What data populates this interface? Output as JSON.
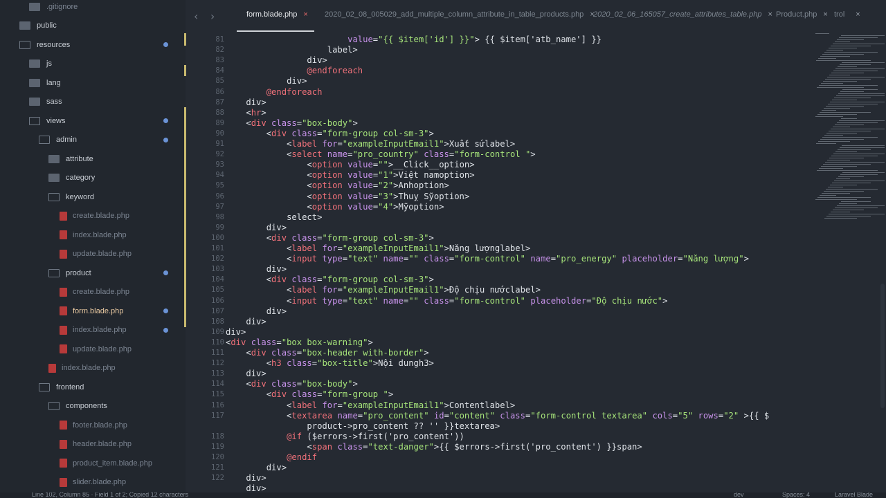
{
  "sidebar": {
    "items": [
      {
        "label": ".gitignore",
        "type": "file-plain",
        "indent": 1,
        "dim": true
      },
      {
        "label": "public",
        "type": "folder",
        "indent": 0
      },
      {
        "label": "resources",
        "type": "folder-open",
        "indent": 0,
        "modified": true
      },
      {
        "label": "js",
        "type": "folder",
        "indent": 1
      },
      {
        "label": "lang",
        "type": "folder",
        "indent": 1
      },
      {
        "label": "sass",
        "type": "folder",
        "indent": 1
      },
      {
        "label": "views",
        "type": "folder-open",
        "indent": 1,
        "modified": true
      },
      {
        "label": "admin",
        "type": "folder-open",
        "indent": 2,
        "modified": true
      },
      {
        "label": "attribute",
        "type": "folder",
        "indent": 3
      },
      {
        "label": "category",
        "type": "folder",
        "indent": 3
      },
      {
        "label": "keyword",
        "type": "folder-open",
        "indent": 3
      },
      {
        "label": "create.blade.php",
        "type": "file",
        "indent": 4,
        "dim": true
      },
      {
        "label": "index.blade.php",
        "type": "file",
        "indent": 4,
        "dim": true
      },
      {
        "label": "update.blade.php",
        "type": "file",
        "indent": 4,
        "dim": true
      },
      {
        "label": "product",
        "type": "folder-open",
        "indent": 3,
        "modified": true
      },
      {
        "label": "create.blade.php",
        "type": "file",
        "indent": 4,
        "dim": true
      },
      {
        "label": "form.blade.php",
        "type": "file",
        "indent": 4,
        "modified": true,
        "active": true
      },
      {
        "label": "index.blade.php",
        "type": "file",
        "indent": 4,
        "modified": true,
        "dim": true
      },
      {
        "label": "update.blade.php",
        "type": "file",
        "indent": 4,
        "dim": true
      },
      {
        "label": "index.blade.php",
        "type": "file",
        "indent": 3,
        "dim": true
      },
      {
        "label": "frontend",
        "type": "folder-open",
        "indent": 2
      },
      {
        "label": "components",
        "type": "folder-open",
        "indent": 3
      },
      {
        "label": "footer.blade.php",
        "type": "file",
        "indent": 4,
        "dim": true
      },
      {
        "label": "header.blade.php",
        "type": "file",
        "indent": 4,
        "dim": true
      },
      {
        "label": "product_item.blade.php",
        "type": "file",
        "indent": 4,
        "dim": true
      },
      {
        "label": "slider.blade.php",
        "type": "file",
        "indent": 4,
        "dim": true
      }
    ]
  },
  "tabs": [
    {
      "label": "form.blade.php",
      "active": true
    },
    {
      "label": "2020_02_08_005029_add_multiple_column_attribute_in_table_products.php",
      "active": false
    },
    {
      "label": "2020_02_06_165057_create_attributes_table.php",
      "active": false
    },
    {
      "label": "Product.php",
      "active": false
    },
    {
      "label": "trol",
      "active": false
    }
  ],
  "nav": {
    "back": "‹",
    "forward": "›"
  },
  "editor": {
    "current_line": 102,
    "lines": [
      {
        "n": "81",
        "html": "                        <span class='a'>value</span>=<span class='s'>\"{{ $item['id'] }}\"</span>> {{ $item['atb_name'] }}"
      },
      {
        "n": "82",
        "html": "                    </<span class='t'>label</span>>"
      },
      {
        "n": "83",
        "html": "                </<span class='t'>div</span>>"
      },
      {
        "n": "84",
        "html": "                <span class='b'>@</span><span class='t'>endforeach</span>"
      },
      {
        "n": "85",
        "html": "            </<span class='t'>div</span>>"
      },
      {
        "n": "86",
        "html": "        <span class='b'>@</span><span class='t'>endforeach</span>"
      },
      {
        "n": "87",
        "html": "    </<span class='t'>div</span>>"
      },
      {
        "n": "88",
        "html": "    <<span class='t'>hr</span>>"
      },
      {
        "n": "89",
        "html": "    <<span class='t'>div</span> <span class='a'>class</span>=<span class='s'>\"box-body\"</span>>"
      },
      {
        "n": "90",
        "html": "        <<span class='t'>div</span> <span class='a'>class</span>=<span class='s'>\"form-group col-sm-3\"</span>>"
      },
      {
        "n": "91",
        "html": "            <<span class='t'>label</span> <span class='a'>for</span>=<span class='s'>\"exampleInputEmail1\"</span>>Xuất sứ</<span class='t'>label</span>>"
      },
      {
        "n": "92",
        "html": "            <<span class='t'>select</span> <span class='a'>name</span>=<span class='s'>\"pro_country\"</span> <span class='a'>class</span>=<span class='s'>\"form-control \"</span>>"
      },
      {
        "n": "93",
        "html": "                <<span class='t'>option</span> <span class='a'>value</span>=<span class='s'>\"\"</span>>__Click__</<span class='t'>option</span>>"
      },
      {
        "n": "94",
        "html": "                <<span class='t'>option</span> <span class='a'>value</span>=<span class='s'>\"1\"</span>>Việt nam</<span class='t'>option</span>>"
      },
      {
        "n": "95",
        "html": "                <<span class='t'>option</span> <span class='a'>value</span>=<span class='s'>\"2\"</span>>Anh</<span class='t'>option</span>>"
      },
      {
        "n": "96",
        "html": "                <<span class='t'>option</span> <span class='a'>value</span>=<span class='s'>\"3\"</span>>Thuỵ Sỹ</<span class='t'>option</span>>"
      },
      {
        "n": "97",
        "html": "                <<span class='t'>option</span> <span class='a'>value</span>=<span class='s'>\"4\"</span>>Mỹ</<span class='t'>option</span>>"
      },
      {
        "n": "98",
        "html": "            </<span class='t'>select</span>>"
      },
      {
        "n": "99",
        "html": "        </<span class='t'>div</span>>"
      },
      {
        "n": "100",
        "html": "        <<span class='t'>div</span> <span class='a'>class</span>=<span class='s'>\"form-group col-sm-3\"</span>>"
      },
      {
        "n": "101",
        "html": "            <<span class='t'>label</span> <span class='a'>for</span>=<span class='s'>\"exampleInputEmail1\"</span>>Năng lượng</<span class='t'>label</span>>"
      },
      {
        "n": "102",
        "html": "            <<span class='t'>input</span> <span class='a'>type</span>=<span class='s'>\"text\"</span> <span class='a'>name</span>=<span class='s'>\"\"</span> <span class='a'>class</span>=<span class='s'>\"form-control\"</span> <span class='a'>name</span>=<span class='s'>\"pro_energy\"</span> <span class='a'>placeholder</span>=<span class='s'>\"Năng lượng\"</span>>"
      },
      {
        "n": "103",
        "html": "        </<span class='t'>div</span>>"
      },
      {
        "n": "104",
        "html": "        <<span class='t'>div</span> <span class='a'>class</span>=<span class='s'>\"form-group col-sm-3\"</span>>"
      },
      {
        "n": "105",
        "html": "            <<span class='t'>label</span> <span class='a'>for</span>=<span class='s'>\"exampleInputEmail1\"</span>>Độ chịu nước</<span class='t'>label</span>>"
      },
      {
        "n": "106",
        "html": "            <<span class='t'>input</span> <span class='a'>type</span>=<span class='s'>\"text\"</span> <span class='a'>name</span>=<span class='s'>\"\"</span> <span class='a'>class</span>=<span class='s'>\"form-control\"</span> <span class='a'>placeholder</span>=<span class='s'>\"Độ chịu nước\"</span>>"
      },
      {
        "n": "107",
        "html": "        </<span class='t'>div</span>>"
      },
      {
        "n": "108",
        "html": "    </<span class='t'>div</span>>"
      },
      {
        "n": "109",
        "html": "</<span class='t'>div</span>>"
      },
      {
        "n": "110",
        "html": "<<span class='t'>div</span> <span class='a'>class</span>=<span class='s'>\"box box-warning\"</span>>"
      },
      {
        "n": "111",
        "html": "    <<span class='t'>div</span> <span class='a'>class</span>=<span class='s'>\"box-header with-border\"</span>>"
      },
      {
        "n": "112",
        "html": "        <<span class='t'>h3</span> <span class='a'>class</span>=<span class='s'>\"box-title\"</span>>Nội dung</<span class='t'>h3</span>>"
      },
      {
        "n": "113",
        "html": "    </<span class='t'>div</span>>"
      },
      {
        "n": "114",
        "html": "    <<span class='t'>div</span> <span class='a'>class</span>=<span class='s'>\"box-body\"</span>>"
      },
      {
        "n": "115",
        "html": "        <<span class='t'>div</span> <span class='a'>class</span>=<span class='s'>\"form-group \"</span>>"
      },
      {
        "n": "116",
        "html": "            <<span class='t'>label</span> <span class='a'>for</span>=<span class='s'>\"exampleInputEmail1\"</span>>Content</<span class='t'>label</span>>"
      },
      {
        "n": "117",
        "html": "            <<span class='t'>textarea</span> <span class='a'>name</span>=<span class='s'>\"pro_content\"</span> <span class='a'>id</span>=<span class='s'>\"content\"</span> <span class='a'>class</span>=<span class='s'>\"form-control textarea\"</span> <span class='a'>cols</span>=<span class='s'>\"5\"</span> <span class='a'>rows</span>=<span class='s'>\"2\"</span> >{{ $"
      },
      {
        "n": "",
        "html": "                product->pro_content ?? '' }}</<span class='t'>textarea</span>>"
      },
      {
        "n": "118",
        "html": "            <span class='b'>@</span><span class='t'>if</span> ($errors->first('pro_content'))"
      },
      {
        "n": "119",
        "html": "                <<span class='t'>span</span> <span class='a'>class</span>=<span class='s'>\"text-danger\"</span>>{{ $errors->first('pro_content') }}</<span class='t'>span</span>>"
      },
      {
        "n": "120",
        "html": "            <span class='b'>@</span><span class='t'>endif</span>"
      },
      {
        "n": "121",
        "html": "        </<span class='t'>div</span>>"
      },
      {
        "n": "122",
        "html": "    </<span class='t'>div</span>>"
      },
      {
        "n": "",
        "html": "    </<span class='t'>div</span>>"
      }
    ]
  },
  "statusbar": {
    "left": "Line 102, Column 85 · Field 1 of 2; Copied 12 characters",
    "branch": "dev",
    "spaces": "Spaces: 4",
    "syntax": "Laravel Blade"
  }
}
